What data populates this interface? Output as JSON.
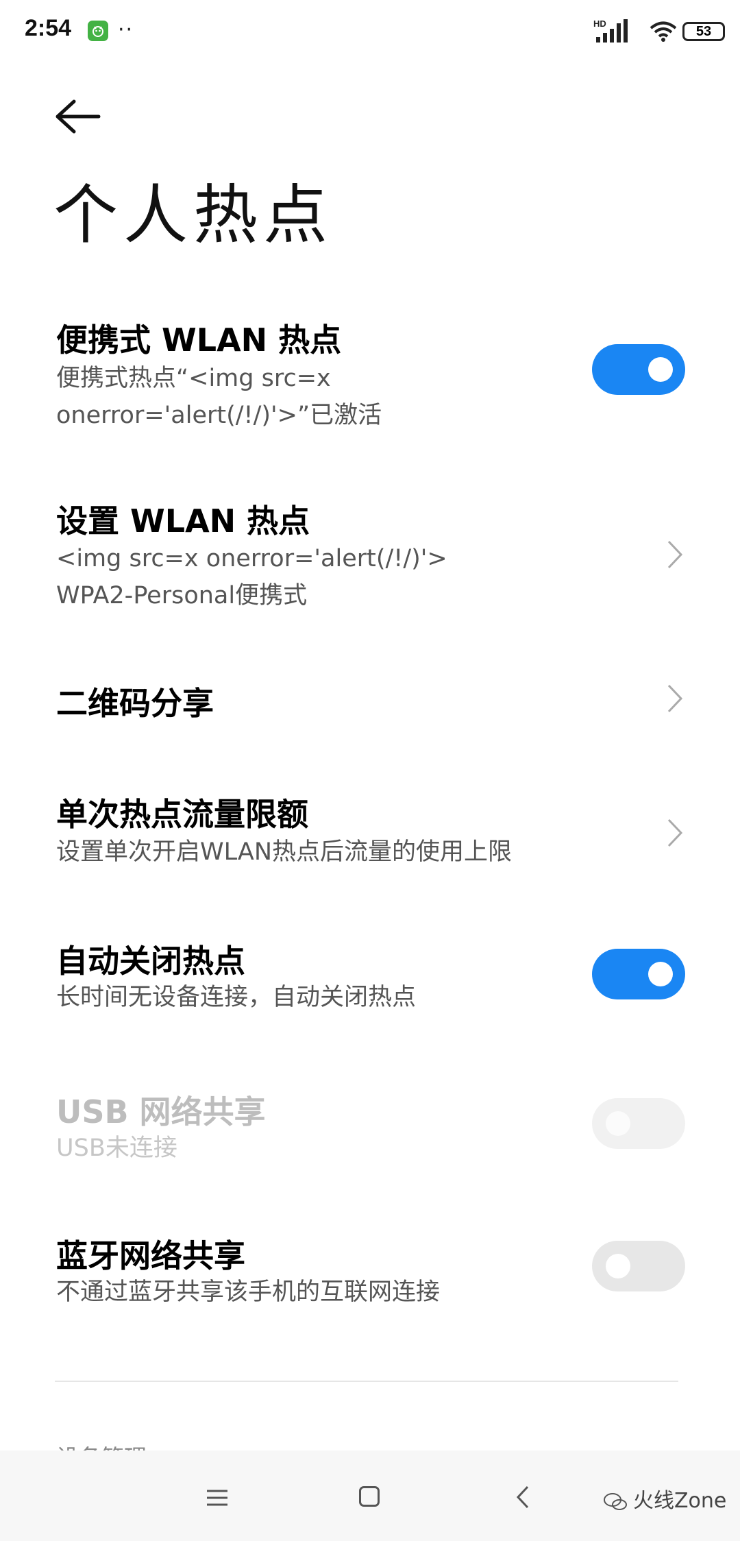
{
  "status_bar": {
    "time": "2:54",
    "dots": "··",
    "network_badge": "HD",
    "battery": "53"
  },
  "header": {
    "back_icon": "arrow-left-icon",
    "title": "个人热点"
  },
  "settings": {
    "portable_hotspot": {
      "title": "便携式 WLAN 热点",
      "subtitle": "便携式热点“<img src=x\nonerror='alert(/!/)'>”已激活",
      "enabled": true
    },
    "setup_hotspot": {
      "title": "设置 WLAN 热点",
      "subtitle": "<img src=x onerror='alert(/!/)'>\nWPA2-Personal便携式"
    },
    "qr_share": {
      "title": "二维码分享"
    },
    "data_limit": {
      "title": "单次热点流量限额",
      "subtitle": "设置单次开启WLAN热点后流量的使用上限"
    },
    "auto_off": {
      "title": "自动关闭热点",
      "subtitle": "长时间无设备连接，自动关闭热点",
      "enabled": true
    },
    "usb_tether": {
      "title": "USB 网络共享",
      "subtitle": "USB未连接",
      "enabled": false,
      "disabled": true
    },
    "bt_tether": {
      "title": "蓝牙网络共享",
      "subtitle": "不通过蓝牙共享该手机的互联网连接",
      "enabled": false
    }
  },
  "section_header": "设备管理",
  "nav_bar": {
    "watermark": "火线Zone"
  },
  "colors": {
    "accent": "#1a86f3",
    "toggle_off": "#e7e7e7",
    "subtitle": "#555555"
  }
}
